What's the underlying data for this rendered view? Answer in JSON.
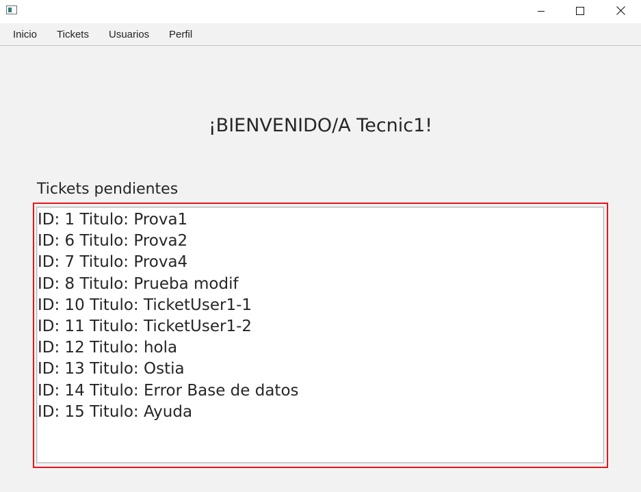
{
  "window": {
    "title": "",
    "controls": {
      "minimize": "minimize-icon",
      "maximize": "maximize-icon",
      "close": "close-icon"
    }
  },
  "menu": {
    "items": [
      {
        "label": "Inicio"
      },
      {
        "label": "Tickets"
      },
      {
        "label": "Usuarios"
      },
      {
        "label": "Perfil"
      }
    ]
  },
  "main": {
    "welcome": "¡BIENVENIDO/A Tecnic1!",
    "pending_label": "Tickets pendientes",
    "tickets": [
      "ID: 1 Titulo: Prova1",
      "ID: 6 Titulo: Prova2",
      "ID: 7 Titulo: Prova4",
      "ID: 8 Titulo: Prueba modif",
      "ID: 10 Titulo: TicketUser1-1",
      "ID: 11 Titulo: TicketUser1-2",
      "ID: 12 Titulo: hola",
      "ID: 13 Titulo: Ostia",
      "ID: 14 Titulo: Error Base de datos",
      "ID: 15 Titulo: Ayuda"
    ]
  },
  "colors": {
    "background": "#f2f2f2",
    "highlight_border": "#e8141b",
    "text": "#262626"
  }
}
